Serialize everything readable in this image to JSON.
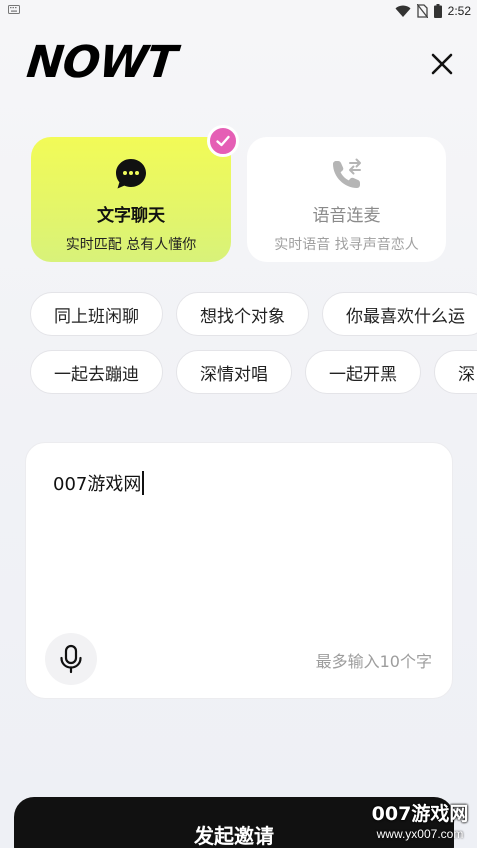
{
  "status_bar": {
    "time": "2:52"
  },
  "header": {
    "logo_text": "NOWT"
  },
  "modes": {
    "text_chat": {
      "title": "文字聊天",
      "subtitle": "实时匹配 总有人懂你",
      "selected": true
    },
    "voice_chat": {
      "title": "语音连麦",
      "subtitle": "实时语音 找寻声音恋人",
      "selected": false
    }
  },
  "topics": {
    "row1": [
      "同上班闲聊",
      "想找个对象",
      "你最喜欢什么运"
    ],
    "row2": [
      "一起去蹦迪",
      "深情对唱",
      "一起开黑",
      "深"
    ]
  },
  "input": {
    "value": "007游戏网",
    "char_limit_hint": "最多输入10个字"
  },
  "invite_button": {
    "label": "发起邀请"
  },
  "watermark": {
    "title": "007游戏网",
    "url": "www.yx007.com"
  },
  "colors": {
    "accent_yellow": "#f2fb57",
    "check_pink": "#e55fb5",
    "button_dark": "#111111"
  },
  "icons": [
    "keyboard-icon",
    "wifi-icon",
    "no-sim-icon",
    "battery-icon",
    "close-icon",
    "chat-bubble-icon",
    "phone-transfer-icon",
    "check-icon",
    "microphone-icon"
  ]
}
